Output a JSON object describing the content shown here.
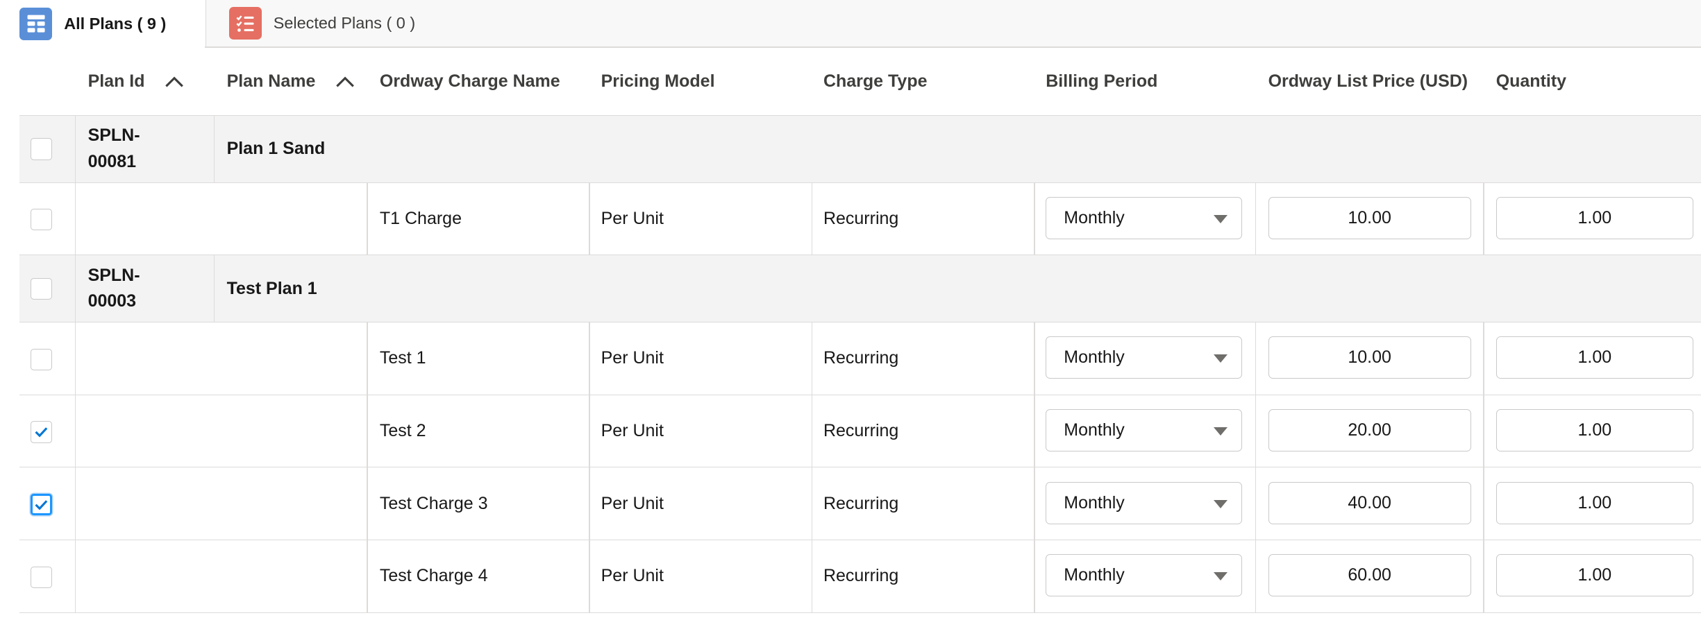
{
  "tabs": {
    "all_plans": "All Plans ( 9 )",
    "selected_plans": "Selected Plans ( 0 )"
  },
  "columns": {
    "plan_id": "Plan Id",
    "plan_name": "Plan Name",
    "charge_name": "Ordway Charge Name",
    "pricing_model": "Pricing Model",
    "charge_type": "Charge Type",
    "billing_period": "Billing Period",
    "list_price": "Ordway List Price (USD)",
    "quantity": "Quantity"
  },
  "plans": [
    {
      "id": "SPLN-00081",
      "id_line1": "SPLN-",
      "id_line2": "00081",
      "name": "Plan 1 Sand",
      "checked": false,
      "charges": [
        {
          "name": "T1 Charge",
          "pricing_model": "Per Unit",
          "charge_type": "Recurring",
          "billing_period": "Monthly",
          "list_price": "10.00",
          "quantity": "1.00",
          "checked": false
        }
      ]
    },
    {
      "id": "SPLN-00003",
      "id_line1": "SPLN-",
      "id_line2": "00003",
      "name": "Test Plan 1",
      "checked": false,
      "charges": [
        {
          "name": "Test 1",
          "pricing_model": "Per Unit",
          "charge_type": "Recurring",
          "billing_period": "Monthly",
          "list_price": "10.00",
          "quantity": "1.00",
          "checked": false
        },
        {
          "name": "Test 2",
          "pricing_model": "Per Unit",
          "charge_type": "Recurring",
          "billing_period": "Monthly",
          "list_price": "20.00",
          "quantity": "1.00",
          "checked": true
        },
        {
          "name": "Test Charge 3",
          "pricing_model": "Per Unit",
          "charge_type": "Recurring",
          "billing_period": "Monthly",
          "list_price": "40.00",
          "quantity": "1.00",
          "checked": true,
          "focused": true
        },
        {
          "name": "Test Charge 4",
          "pricing_model": "Per Unit",
          "charge_type": "Recurring",
          "billing_period": "Monthly",
          "list_price": "60.00",
          "quantity": "1.00",
          "checked": false
        }
      ]
    }
  ],
  "colors": {
    "tab_all_icon": "#5a8fd8",
    "tab_selected_icon": "#e56f62",
    "check_accent": "#0176d3",
    "plan_row_bg": "#f3f3f3"
  },
  "icons": {
    "all_plans_tab": "table-icon",
    "selected_plans_tab": "checklist-icon",
    "sort": "chevron-up-icon",
    "billing_dropdown": "caret-down-icon",
    "row_check": "check-icon"
  }
}
